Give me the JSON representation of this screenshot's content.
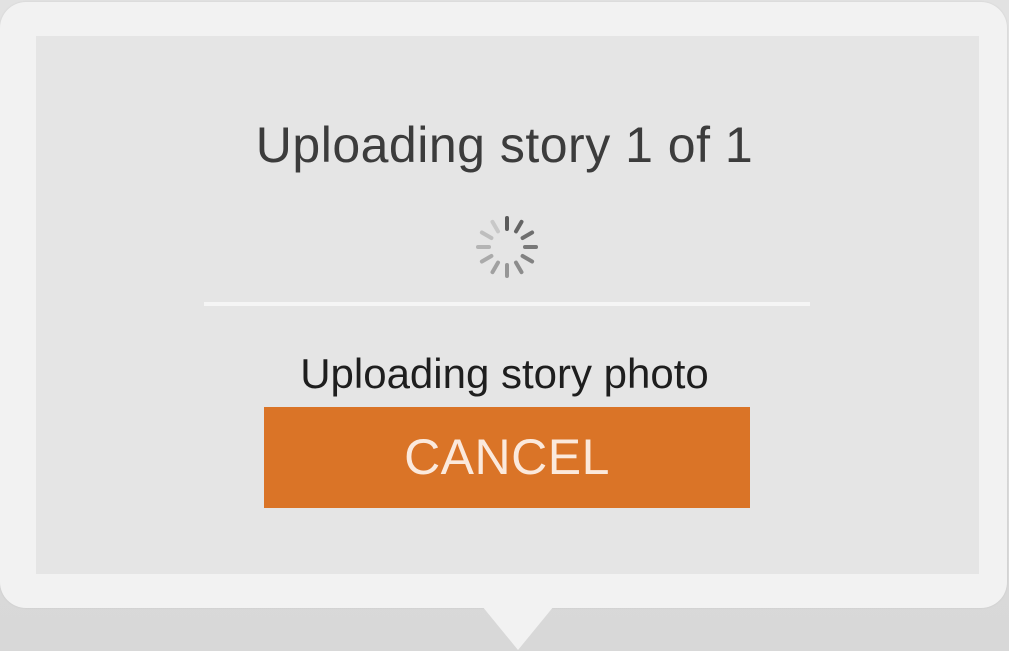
{
  "dialog": {
    "title": "Uploading story 1 of 1",
    "status": "Uploading story photo",
    "cancel_label": "CANCEL"
  },
  "icons": {
    "spinner": "loading-spinner-icon"
  },
  "colors": {
    "accent": "#da7427",
    "panel": "#e5e5e5",
    "frame": "#f2f2f2"
  }
}
